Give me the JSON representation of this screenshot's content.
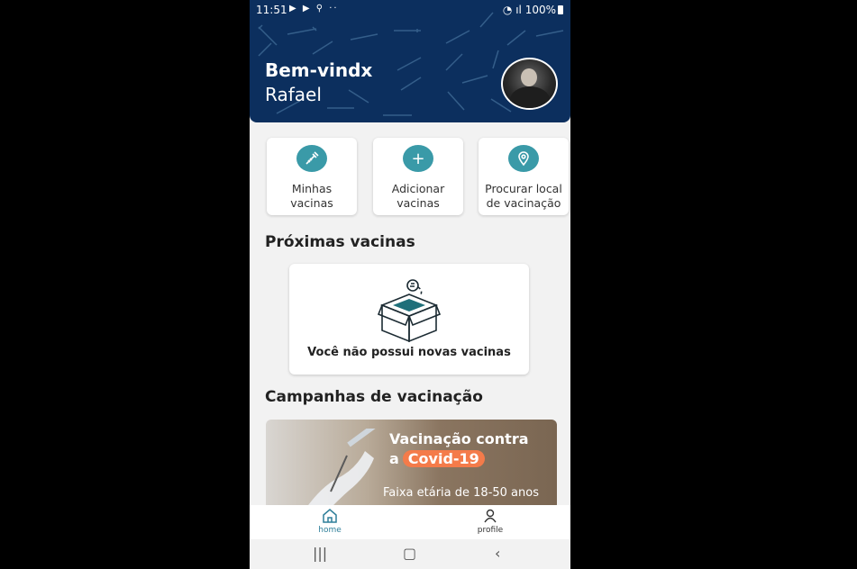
{
  "status": {
    "time": "11:51",
    "left_icons": "▶ ▶ ⚲ ··",
    "battery": "100%"
  },
  "header": {
    "greeting": "Bem-vindx",
    "name": "Rafael"
  },
  "quick_actions": [
    {
      "label_1": "Minhas",
      "label_2": "vacinas",
      "icon": "syringe-icon"
    },
    {
      "label_1": "Adicionar",
      "label_2": "vacinas",
      "icon": "plus-icon"
    },
    {
      "label_1": "Procurar local",
      "label_2": "de vacinação",
      "icon": "location-icon"
    }
  ],
  "next_vaccines": {
    "title": "Próximas vacinas",
    "empty_message": "Você não possui novas vacinas"
  },
  "campaigns": {
    "title": "Campanhas de vacinação",
    "banner_line1": "Vacinação contra",
    "banner_prefix": "a",
    "banner_highlight": "Covid-19",
    "banner_subtitle": "Faixa etária de 18-50 anos"
  },
  "bottom_nav": {
    "home": "home",
    "profile": "profile"
  },
  "colors": {
    "header_bg": "#0c2f5e",
    "accent_teal": "#3a9aa8",
    "covid_badge": "#f47b4a"
  }
}
